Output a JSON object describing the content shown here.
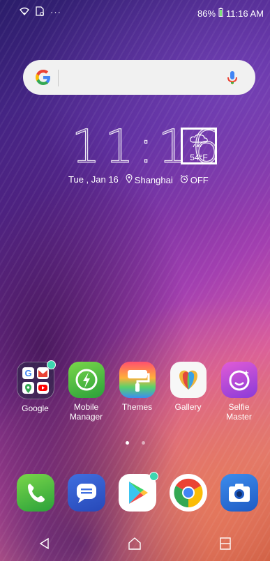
{
  "status_bar": {
    "icons": [
      "wifi-icon",
      "storage-notification-icon",
      "more-notifications-icon"
    ],
    "battery_percent": "86%",
    "time": "11:16 AM"
  },
  "search_bar": {
    "logo": "G",
    "mic_icon": "mic-icon"
  },
  "clock_widget": {
    "time": "11:16",
    "date": "Tue , Jan 16",
    "location": "Shanghai",
    "alarm": "OFF",
    "weather": {
      "icon": "rain-cloud-icon",
      "temperature": "54°F"
    }
  },
  "apps": [
    {
      "label": "Google",
      "icon": "google-folder-icon"
    },
    {
      "label": "Mobile Manager",
      "icon": "mobile-manager-icon"
    },
    {
      "label": "Themes",
      "icon": "themes-icon"
    },
    {
      "label": "Gallery",
      "icon": "gallery-icon"
    },
    {
      "label": "Selfie Master",
      "icon": "selfie-master-icon"
    }
  ],
  "page_indicator": {
    "pages": 2,
    "current": 1
  },
  "dock": [
    {
      "icon": "phone-icon"
    },
    {
      "icon": "messages-icon"
    },
    {
      "icon": "play-store-icon"
    },
    {
      "icon": "chrome-icon"
    },
    {
      "icon": "camera-icon"
    }
  ],
  "nav_bar": {
    "back": "back-icon",
    "home": "home-icon",
    "recents": "recents-icon"
  }
}
